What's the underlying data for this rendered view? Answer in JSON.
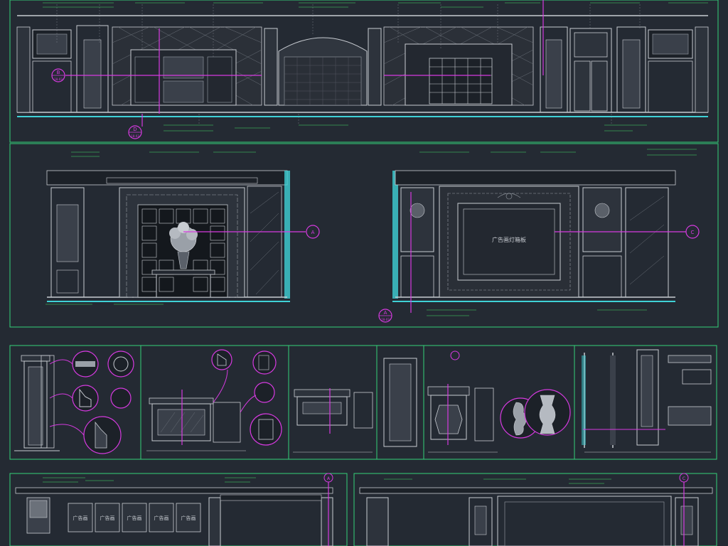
{
  "colors": {
    "background": "#242a33",
    "frame": "#33d17a",
    "line": "#c8ccd2",
    "leader": "#d63ae0",
    "annotation": "#42e06a",
    "dim": "#8a9099",
    "cyan": "#3fd1d6"
  },
  "section_markers": [
    {
      "letter": "B",
      "ref": "18-03"
    },
    {
      "letter": "D",
      "ref": "18-03"
    },
    {
      "letter": "A",
      "ref": "18-03"
    },
    {
      "letter": "A",
      "ref": "18-03"
    },
    {
      "letter": "C",
      "ref": "18-03"
    },
    {
      "letter": "A",
      "ref": ""
    },
    {
      "letter": "C",
      "ref": ""
    }
  ],
  "panel_labels": {
    "ad_lightbox_right": "广告画灯箱板",
    "ad_panel": "广告画"
  },
  "bottom_ad_panels": [
    "广告画",
    "广告画",
    "广告画",
    "广告画",
    "广告画"
  ]
}
